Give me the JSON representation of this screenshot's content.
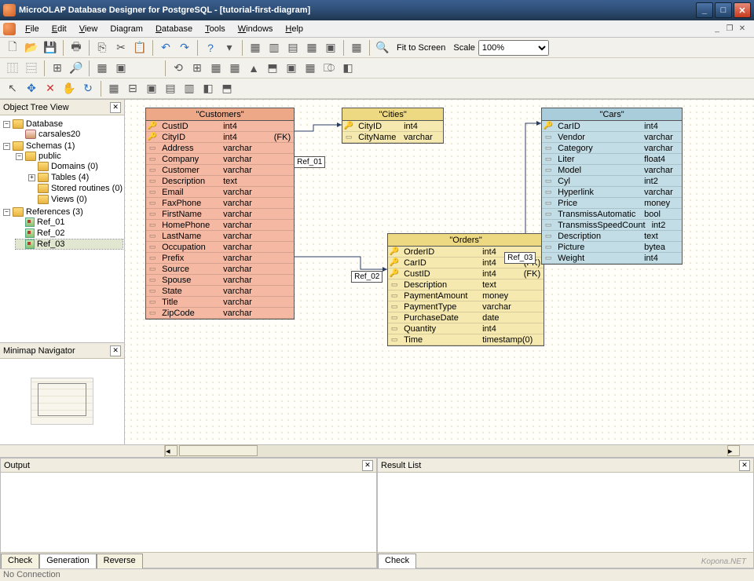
{
  "app": {
    "title": "MicroOLAP Database Designer for PostgreSQL  -  [tutorial-first-diagram]"
  },
  "menu": [
    "File",
    "Edit",
    "View",
    "Diagram",
    "Database",
    "Tools",
    "Windows",
    "Help"
  ],
  "toolbar": {
    "fit_label": "Fit to Screen",
    "scale_label": "Scale",
    "scale_value": "100%"
  },
  "panels": {
    "tree_title": "Object Tree View",
    "minimap_title": "Minimap Navigator",
    "output_title": "Output",
    "result_title": "Result List"
  },
  "tree": {
    "root_db": "Database",
    "db_name": "carsales20",
    "schemas": "Schemas (1)",
    "public": "public",
    "domains": "Domains (0)",
    "tables": "Tables (4)",
    "stored": "Stored routines (0)",
    "views": "Views (0)",
    "refs_root": "References (3)",
    "refs": [
      "Ref_01",
      "Ref_02",
      "Ref_03"
    ]
  },
  "tables": {
    "customers": {
      "title": "\"Customers\"",
      "cols": [
        {
          "n": "CustID",
          "t": "int4",
          "k": true
        },
        {
          "n": "CityID",
          "t": "int4",
          "k": true,
          "fk": "(FK)"
        },
        {
          "n": "Address",
          "t": "varchar"
        },
        {
          "n": "Company",
          "t": "varchar"
        },
        {
          "n": "Customer",
          "t": "varchar"
        },
        {
          "n": "Description",
          "t": "text"
        },
        {
          "n": "Email",
          "t": "varchar"
        },
        {
          "n": "FaxPhone",
          "t": "varchar"
        },
        {
          "n": "FirstName",
          "t": "varchar"
        },
        {
          "n": "HomePhone",
          "t": "varchar"
        },
        {
          "n": "LastName",
          "t": "varchar"
        },
        {
          "n": "Occupation",
          "t": "varchar"
        },
        {
          "n": "Prefix",
          "t": "varchar"
        },
        {
          "n": "Source",
          "t": "varchar"
        },
        {
          "n": "Spouse",
          "t": "varchar"
        },
        {
          "n": "State",
          "t": "varchar"
        },
        {
          "n": "Title",
          "t": "varchar"
        },
        {
          "n": "ZipCode",
          "t": "varchar"
        }
      ]
    },
    "cities": {
      "title": "\"Cities\"",
      "cols": [
        {
          "n": "CityID",
          "t": "int4",
          "k": true
        },
        {
          "n": "CityName",
          "t": "varchar"
        }
      ]
    },
    "orders": {
      "title": "\"Orders\"",
      "cols": [
        {
          "n": "OrderID",
          "t": "int4",
          "k": true
        },
        {
          "n": "CarID",
          "t": "int4",
          "k": true,
          "fk": "(FK)"
        },
        {
          "n": "CustID",
          "t": "int4",
          "k": true,
          "fk": "(FK)"
        },
        {
          "n": "Description",
          "t": "text"
        },
        {
          "n": "PaymentAmount",
          "t": "money"
        },
        {
          "n": "PaymentType",
          "t": "varchar"
        },
        {
          "n": "PurchaseDate",
          "t": "date"
        },
        {
          "n": "Quantity",
          "t": "int4"
        },
        {
          "n": "Time",
          "t": "timestamp(0)"
        }
      ]
    },
    "cars": {
      "title": "\"Cars\"",
      "cols": [
        {
          "n": "CarID",
          "t": "int4",
          "k": true
        },
        {
          "n": "Vendor",
          "t": "varchar"
        },
        {
          "n": "Category",
          "t": "varchar"
        },
        {
          "n": "Liter",
          "t": "float4"
        },
        {
          "n": "Model",
          "t": "varchar"
        },
        {
          "n": "Cyl",
          "t": "int2"
        },
        {
          "n": "Hyperlink",
          "t": "varchar"
        },
        {
          "n": "Price",
          "t": "money"
        },
        {
          "n": "TransmissAutomatic",
          "t": "bool"
        },
        {
          "n": "TransmissSpeedCount",
          "t": "int2"
        },
        {
          "n": "Description",
          "t": "text"
        },
        {
          "n": "Picture",
          "t": "bytea"
        },
        {
          "n": "Weight",
          "t": "int4"
        }
      ]
    }
  },
  "refs": {
    "r1": "Ref_01",
    "r2": "Ref_02",
    "r3": "Ref_03"
  },
  "tabs": {
    "check": "Check",
    "generation": "Generation",
    "reverse": "Reverse"
  },
  "palette": [
    "#ffffff",
    "#ff00ff",
    "#800080",
    "#00a080",
    "#008040",
    "#bdb76b",
    "#000080",
    "#4b0082",
    "#8a2be2",
    "#7b68ee",
    "#6a5acd",
    "#87cefa",
    "#98c8a8",
    "#b0c4de",
    "#c0c0c0",
    "#f0d0a0",
    "#ffe4b5",
    "#ffffe0",
    "#fffacd",
    "#ffffff",
    "#ffff00",
    "#c0b030"
  ],
  "status": "No Connection",
  "watermark": "Kopona.NET"
}
